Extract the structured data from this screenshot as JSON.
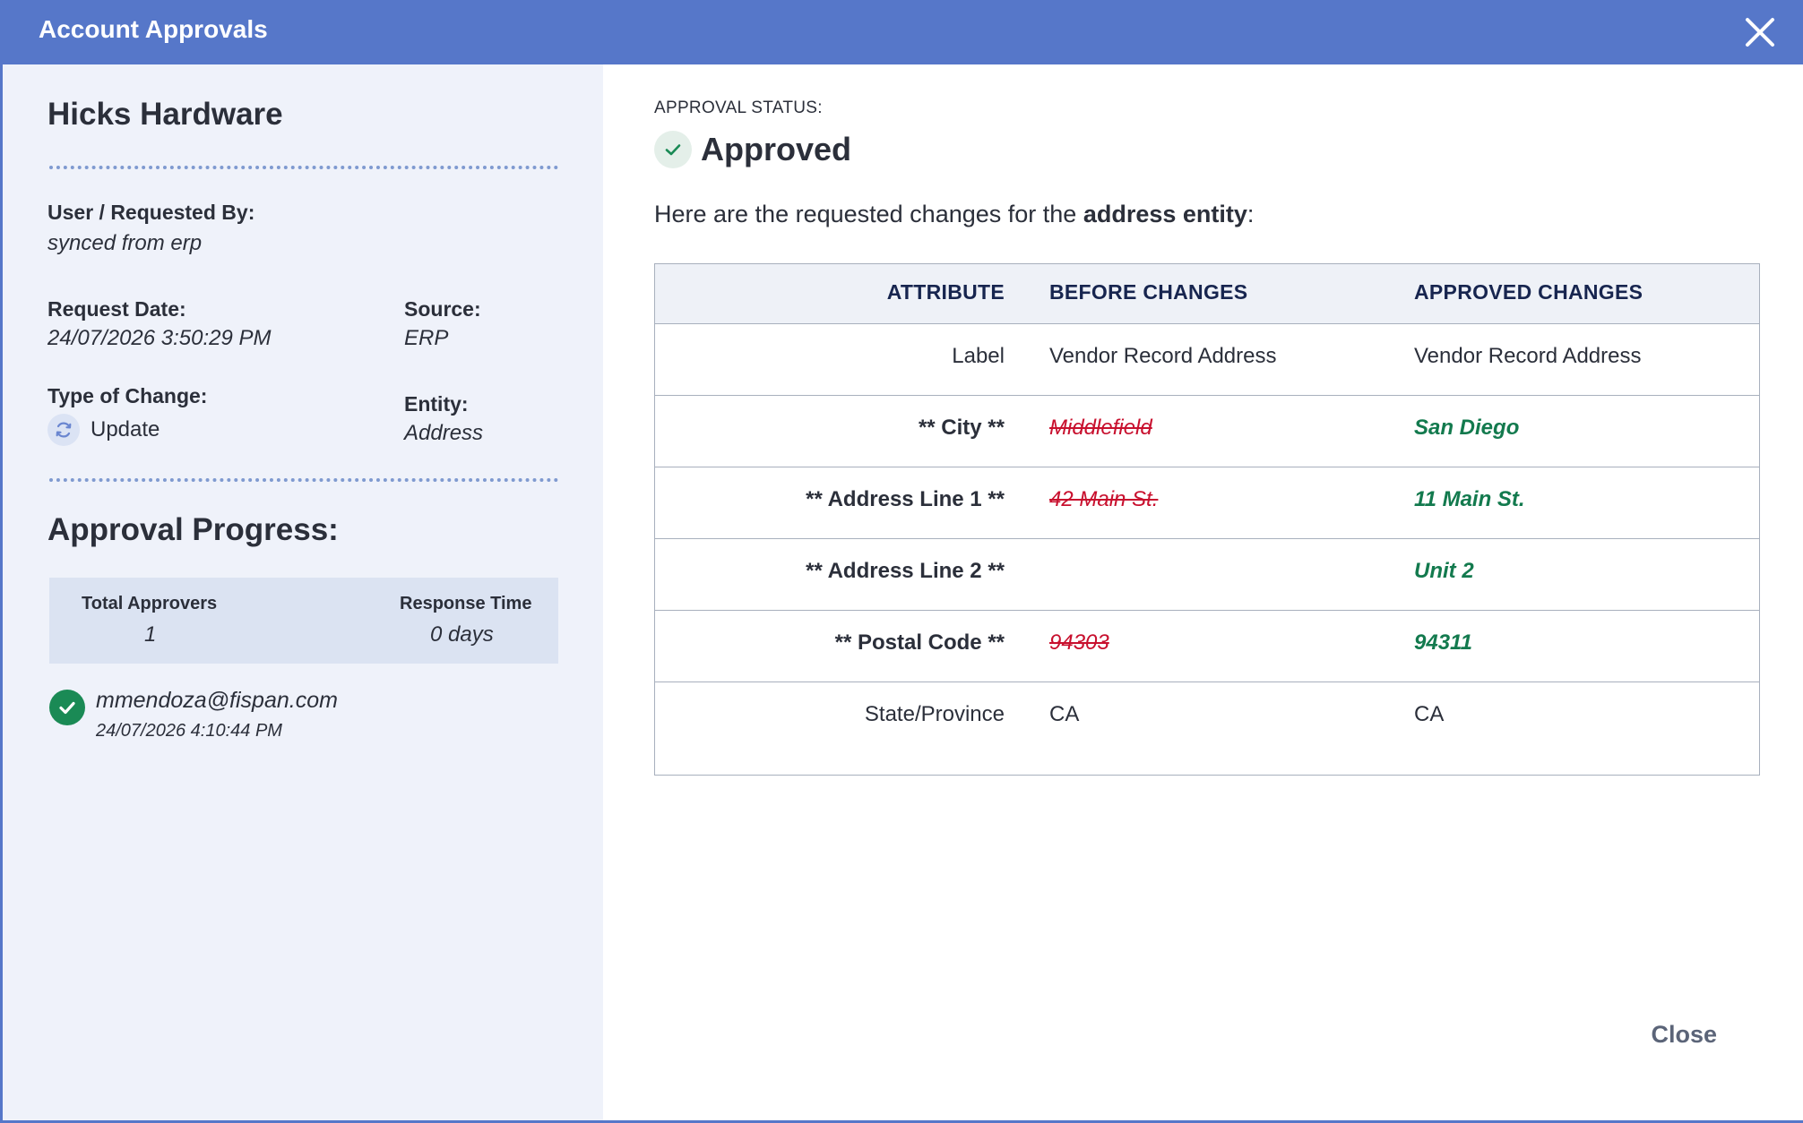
{
  "header": {
    "title": "Account Approvals"
  },
  "left": {
    "company": "Hicks Hardware",
    "requested_by": {
      "label": "User / Requested By:",
      "value": "synced from erp"
    },
    "request_date": {
      "label": "Request Date:",
      "value": "24/07/2026 3:50:29 PM"
    },
    "source": {
      "label": "Source:",
      "value": "ERP"
    },
    "type_of_change": {
      "label": "Type of Change:",
      "value": "Update"
    },
    "entity": {
      "label": "Entity:",
      "value": "Address"
    },
    "progress": {
      "title": "Approval Progress:",
      "total_label": "Total Approvers",
      "total_value": "1",
      "response_label": "Response Time",
      "response_value": "0 days"
    },
    "approver": {
      "email": "mmendoza@fispan.com",
      "time": "24/07/2026 4:10:44 PM"
    }
  },
  "right": {
    "status_label": "APPROVAL STATUS:",
    "status": "Approved",
    "intro_prefix": "Here are the requested changes for the ",
    "intro_bold": "address entity",
    "intro_suffix": ":",
    "table": {
      "headers": [
        "ATTRIBUTE",
        "BEFORE CHANGES",
        "APPROVED CHANGES"
      ],
      "rows": [
        {
          "attribute": "Label",
          "before": "Vendor Record Address",
          "after": "Vendor Record Address",
          "changed": false
        },
        {
          "attribute": "** City **",
          "before": "Middlefield",
          "after": "San Diego",
          "changed": true
        },
        {
          "attribute": "** Address Line 1 **",
          "before": "42 Main St.",
          "after": "11 Main St.",
          "changed": true
        },
        {
          "attribute": "** Address Line 2 **",
          "before": "",
          "after": "Unit 2",
          "changed": true
        },
        {
          "attribute": "** Postal Code **",
          "before": "94303",
          "after": "94311",
          "changed": true
        },
        {
          "attribute": "State/Province",
          "before": "CA",
          "after": "CA",
          "changed": false
        }
      ]
    },
    "close_label": "Close"
  },
  "colors": {
    "header_bg": "#5677c9",
    "left_bg": "#eff2fa",
    "removed": "#c8102e",
    "added": "#137a4e",
    "approved_check": "#1a8a55"
  },
  "icons": {
    "close": "close-icon",
    "update": "refresh-icon",
    "status": "checkmark-icon",
    "approver": "check-circle-icon"
  }
}
